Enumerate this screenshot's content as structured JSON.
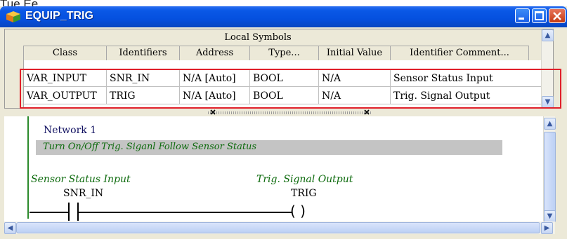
{
  "page_text": "Tue Ee",
  "window": {
    "title": "EQUIP_TRIG"
  },
  "symbols": {
    "heading": "Local Symbols",
    "columns": [
      "Class",
      "Identifiers",
      "Address",
      "Type...",
      "Initial Value",
      "Identifier Comment..."
    ],
    "rows": [
      [
        "VAR_INPUT",
        "SNR_IN",
        "N/A [Auto]",
        "BOOL",
        "N/A",
        "Sensor Status Input"
      ],
      [
        "VAR_OUTPUT",
        "TRIG",
        "N/A [Auto]",
        "BOOL",
        "N/A",
        "Trig. Signal Output"
      ]
    ]
  },
  "ladder": {
    "network_label": "Network 1",
    "network_comment": "Turn On/Off Trig. Siganl Follow Sensor Status",
    "contact": {
      "comment": "Sensor Status Input",
      "identifier": "SNR_IN"
    },
    "coil": {
      "comment": "Trig. Signal Output",
      "identifier": "TRIG",
      "symbol": "(   )"
    }
  },
  "icons": {
    "app": "cube-icon",
    "minimize": "minimize-icon",
    "maximize": "maximize-icon",
    "close": "close-icon",
    "scroll_up": "up-arrow-icon",
    "scroll_down": "down-arrow-icon",
    "scroll_left": "left-arrow-icon",
    "scroll_right": "right-arrow-icon",
    "split_collapse": "x-icon"
  },
  "colors": {
    "titlebar": "#0550df",
    "highlight": "#e0202a",
    "comment_text": "#0c6a0c",
    "comment_bar": "#c4c4c4"
  }
}
